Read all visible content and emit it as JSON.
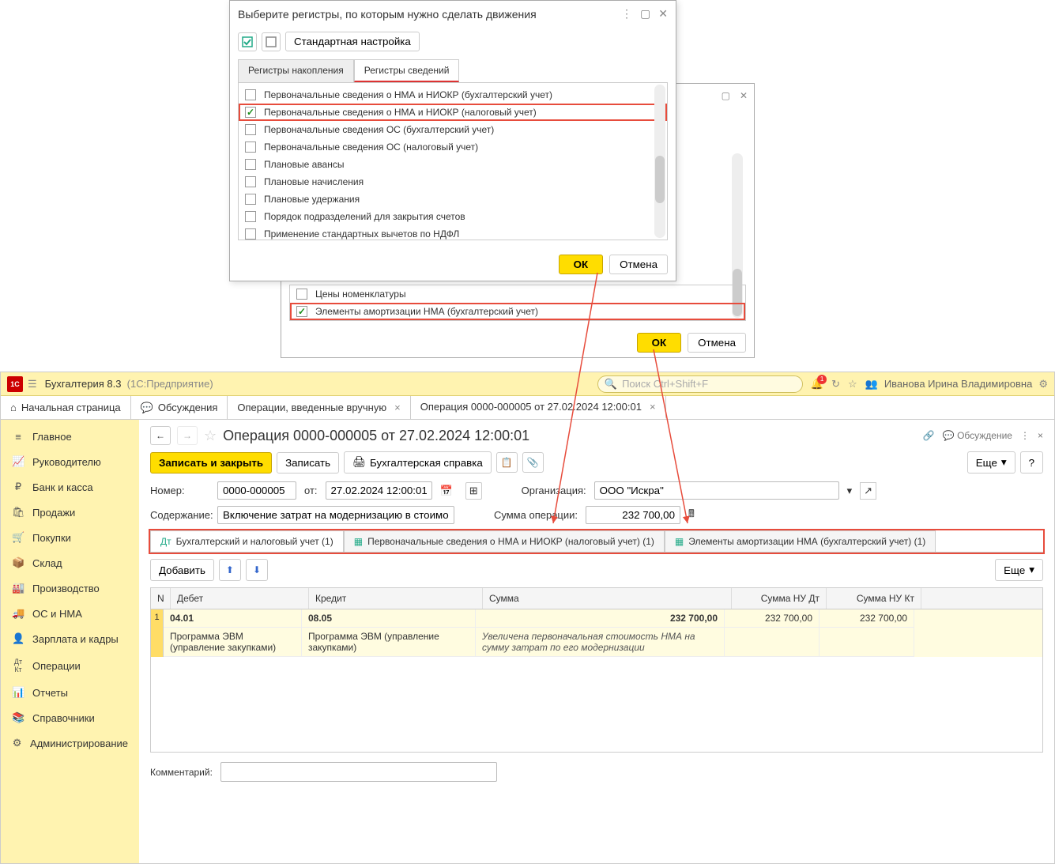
{
  "dialog1": {
    "title": "Выберите регистры, по которым нужно сделать движения",
    "std_setup": "Стандартная настройка",
    "tabs": {
      "accum": "Регистры накопления",
      "info": "Регистры сведений"
    },
    "items": [
      {
        "label": "Первоначальные сведения о НМА и НИОКР (бухгалтерский учет)",
        "checked": false
      },
      {
        "label": "Первоначальные сведения о НМА и НИОКР (налоговый учет)",
        "checked": true
      },
      {
        "label": "Первоначальные сведения ОС (бухгалтерский учет)",
        "checked": false
      },
      {
        "label": "Первоначальные сведения ОС (налоговый учет)",
        "checked": false
      },
      {
        "label": "Плановые авансы",
        "checked": false
      },
      {
        "label": "Плановые начисления",
        "checked": false
      },
      {
        "label": "Плановые удержания",
        "checked": false
      },
      {
        "label": "Порядок подразделений для закрытия счетов",
        "checked": false
      },
      {
        "label": "Применение стандартных вычетов по НДФЛ",
        "checked": false
      }
    ],
    "ok": "ОК",
    "cancel": "Отмена"
  },
  "dialog2": {
    "items": [
      {
        "label": "Цены номенклатуры",
        "checked": false
      },
      {
        "label": "Элементы амортизации НМА (бухгалтерский учет)",
        "checked": true
      }
    ],
    "ok": "ОК",
    "cancel": "Отмена"
  },
  "titlebar": {
    "app": "Бухгалтерия 8.3",
    "sub": "(1С:Предприятие)",
    "search_ph": "Поиск Ctrl+Shift+F",
    "user": "Иванова Ирина Владимировна",
    "notif_count": "1"
  },
  "tabs": {
    "home": "Начальная страница",
    "discuss": "Обсуждения",
    "ops": "Операции, введенные вручную",
    "op": "Операция 0000-000005 от 27.02.2024 12:00:01"
  },
  "sidebar": [
    {
      "icon": "≡",
      "label": "Главное"
    },
    {
      "icon": "📈",
      "label": "Руководителю"
    },
    {
      "icon": "₽",
      "label": "Банк и касса"
    },
    {
      "icon": "🛍",
      "label": "Продажи"
    },
    {
      "icon": "🛒",
      "label": "Покупки"
    },
    {
      "icon": "📦",
      "label": "Склад"
    },
    {
      "icon": "🏭",
      "label": "Производство"
    },
    {
      "icon": "🚚",
      "label": "ОС и НМА"
    },
    {
      "icon": "👤",
      "label": "Зарплата и кадры"
    },
    {
      "icon": "Дт",
      "label": "Операции"
    },
    {
      "icon": "📊",
      "label": "Отчеты"
    },
    {
      "icon": "📚",
      "label": "Справочники"
    },
    {
      "icon": "⚙",
      "label": "Администрирование"
    }
  ],
  "page": {
    "title": "Операция 0000-000005 от 27.02.2024 12:00:01",
    "discuss": "Обсуждение"
  },
  "actions": {
    "save_close": "Записать и закрыть",
    "save": "Записать",
    "print": "Бухгалтерская справка",
    "more": "Еще",
    "help": "?"
  },
  "form": {
    "number_lbl": "Номер:",
    "number": "0000-000005",
    "from_lbl": "от:",
    "date": "27.02.2024 12:00:01",
    "org_lbl": "Организация:",
    "org": "ООО \"Искра\"",
    "content_lbl": "Содержание:",
    "content": "Включение затрат на модернизацию в стоимость НМА",
    "sum_lbl": "Сумма операции:",
    "sum": "232 700,00"
  },
  "doc_tabs": {
    "t1": "Бухгалтерский и налоговый учет (1)",
    "t2": "Первоначальные сведения о НМА и НИОКР (налоговый учет) (1)",
    "t3": "Элементы амортизации НМА (бухгалтерский учет) (1)"
  },
  "table_actions": {
    "add": "Добавить",
    "more": "Еще"
  },
  "grid": {
    "headers": {
      "n": "N",
      "debit": "Дебет",
      "credit": "Кредит",
      "sum": "Сумма",
      "nudt": "Сумма НУ Дт",
      "nukt": "Сумма НУ Кт"
    },
    "row": {
      "n": "1",
      "debit_acc": "04.01",
      "credit_acc": "08.05",
      "sum": "232 700,00",
      "nudt": "232 700,00",
      "nukt": "232 700,00",
      "debit_sub": "Программа ЭВМ (управление закупками)",
      "credit_sub": "Программа ЭВМ (управление закупками)",
      "note": "Увеличена первоначальная стоимость НМА на сумму затрат по его модернизации"
    }
  },
  "comment_lbl": "Комментарий:"
}
